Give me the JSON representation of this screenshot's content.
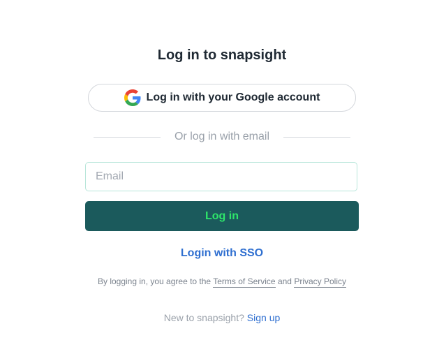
{
  "page": {
    "title": "Log in to snapsight"
  },
  "google": {
    "icon": "google-g-icon",
    "label": "Log in with your Google account"
  },
  "divider": {
    "text": "Or log in with email"
  },
  "email": {
    "placeholder": "Email",
    "value": ""
  },
  "login": {
    "label": "Log in"
  },
  "sso": {
    "label": "Login with SSO"
  },
  "terms": {
    "prefix": "By logging in, you agree to the",
    "terms_link": "Terms of Service",
    "and": "and",
    "privacy_link": "Privacy Policy"
  },
  "signup": {
    "prompt": "New to snapsight?",
    "link": "Sign up"
  },
  "colors": {
    "primary_button_bg": "#1b5a5c",
    "primary_button_text": "#2ee56a",
    "link": "#2f6fd0",
    "input_border": "#b8e6da"
  }
}
